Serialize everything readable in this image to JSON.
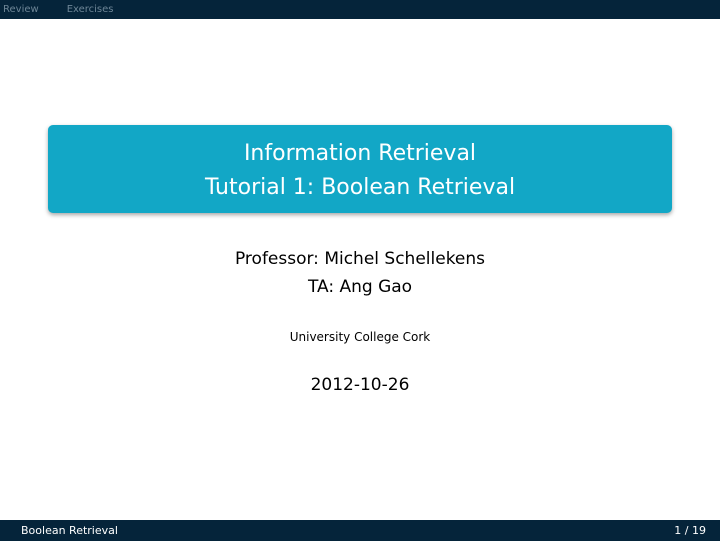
{
  "nav": {
    "items": [
      {
        "label": "Review"
      },
      {
        "label": "Exercises"
      }
    ]
  },
  "title": {
    "line1": "Information Retrieval",
    "line2": "Tutorial 1:  Boolean Retrieval"
  },
  "authors": {
    "line1": "Professor:  Michel Schellekens",
    "line2": "TA: Ang Gao"
  },
  "institute": "University College Cork",
  "date": "2012-10-26",
  "footer": {
    "short_title": "Boolean Retrieval",
    "page": "1 / 19"
  },
  "colors": {
    "header_bar": "#05243a",
    "title_box": "#12a7c6",
    "nav_text": "#6d8596"
  }
}
